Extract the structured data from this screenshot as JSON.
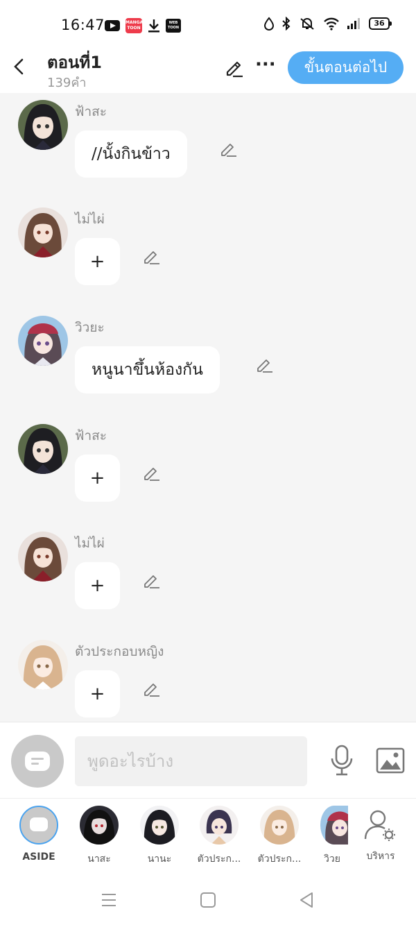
{
  "status_bar": {
    "time": "16:47",
    "app_icons": [
      "youtube-icon",
      "mangatoon-icon",
      "download-icon",
      "webtoon-icon"
    ],
    "mangatoon_text": "MANGA TOON",
    "webtoon_text": "WEB TOON",
    "battery": "36"
  },
  "header": {
    "title": "ตอนที่1",
    "word_count": "139คำ",
    "next_label": "ขั้นตอนต่อไป",
    "accent": "#55adf4"
  },
  "messages": [
    {
      "sender": "ฟ้าสะ",
      "text": "//นั้งกินข้าว"
    },
    {
      "sender": "ไม่ไผ่",
      "text": "+"
    },
    {
      "sender": "วิวยะ",
      "text": "หนูนาขึ้นห้องกัน"
    },
    {
      "sender": "ฟ้าสะ",
      "text": "+"
    },
    {
      "sender": "ไม่ไผ่",
      "text": "+"
    },
    {
      "sender": "ตัวประกอบหญิง",
      "text": "+"
    }
  ],
  "input": {
    "placeholder": "พูดอะไรบ้าง"
  },
  "characters": [
    {
      "label": "ASIDE"
    },
    {
      "label": "นาสะ"
    },
    {
      "label": "นานะ"
    },
    {
      "label": "ตัวประก..."
    },
    {
      "label": "ตัวประก..."
    },
    {
      "label": "วิวย"
    },
    {
      "label": "บริหาร"
    }
  ]
}
